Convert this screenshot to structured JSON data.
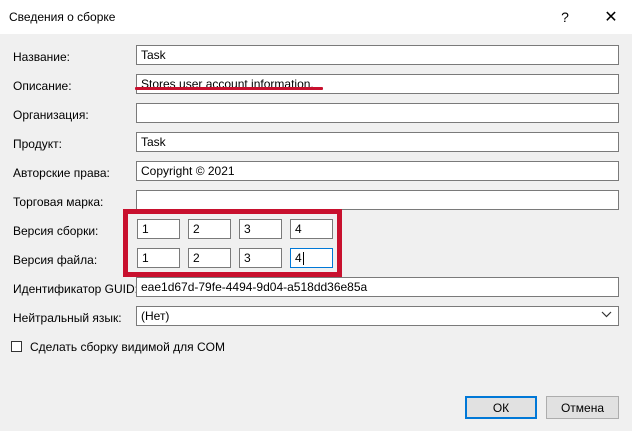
{
  "window": {
    "title": "Сведения о сборке"
  },
  "titlebar": {
    "help_glyph": "?",
    "close_glyph": "✕"
  },
  "labels": {
    "name": "Название:",
    "description": "Описание:",
    "organization": "Организация:",
    "product": "Продукт:",
    "copyright": "Авторские права:",
    "trademark": "Торговая марка:",
    "assembly_version": "Версия сборки:",
    "file_version": "Версия файла:",
    "guid": "Идентификатор GUID:",
    "neutral_language": "Нейтральный язык:"
  },
  "fields": {
    "name": "Task",
    "description": "Stores user account information.",
    "organization": "",
    "product": "Task",
    "copyright": "Copyright ©  2021",
    "trademark": "",
    "assembly_version": [
      "1",
      "2",
      "3",
      "4"
    ],
    "file_version": [
      "1",
      "2",
      "3",
      "4"
    ],
    "guid": "eae1d67d-79fe-4494-9d04-a518dd36e85a",
    "neutral_language": "(Нет)"
  },
  "com_visible": {
    "label": "Сделать сборку видимой для COM",
    "checked": false
  },
  "buttons": {
    "ok": "ОК",
    "cancel": "Отмена"
  },
  "colors": {
    "highlight_red": "#c8102e",
    "focus_blue": "#0078d7"
  },
  "icons": {
    "dropdown": "chevron-down-icon",
    "help": "help-icon",
    "close": "close-icon"
  }
}
